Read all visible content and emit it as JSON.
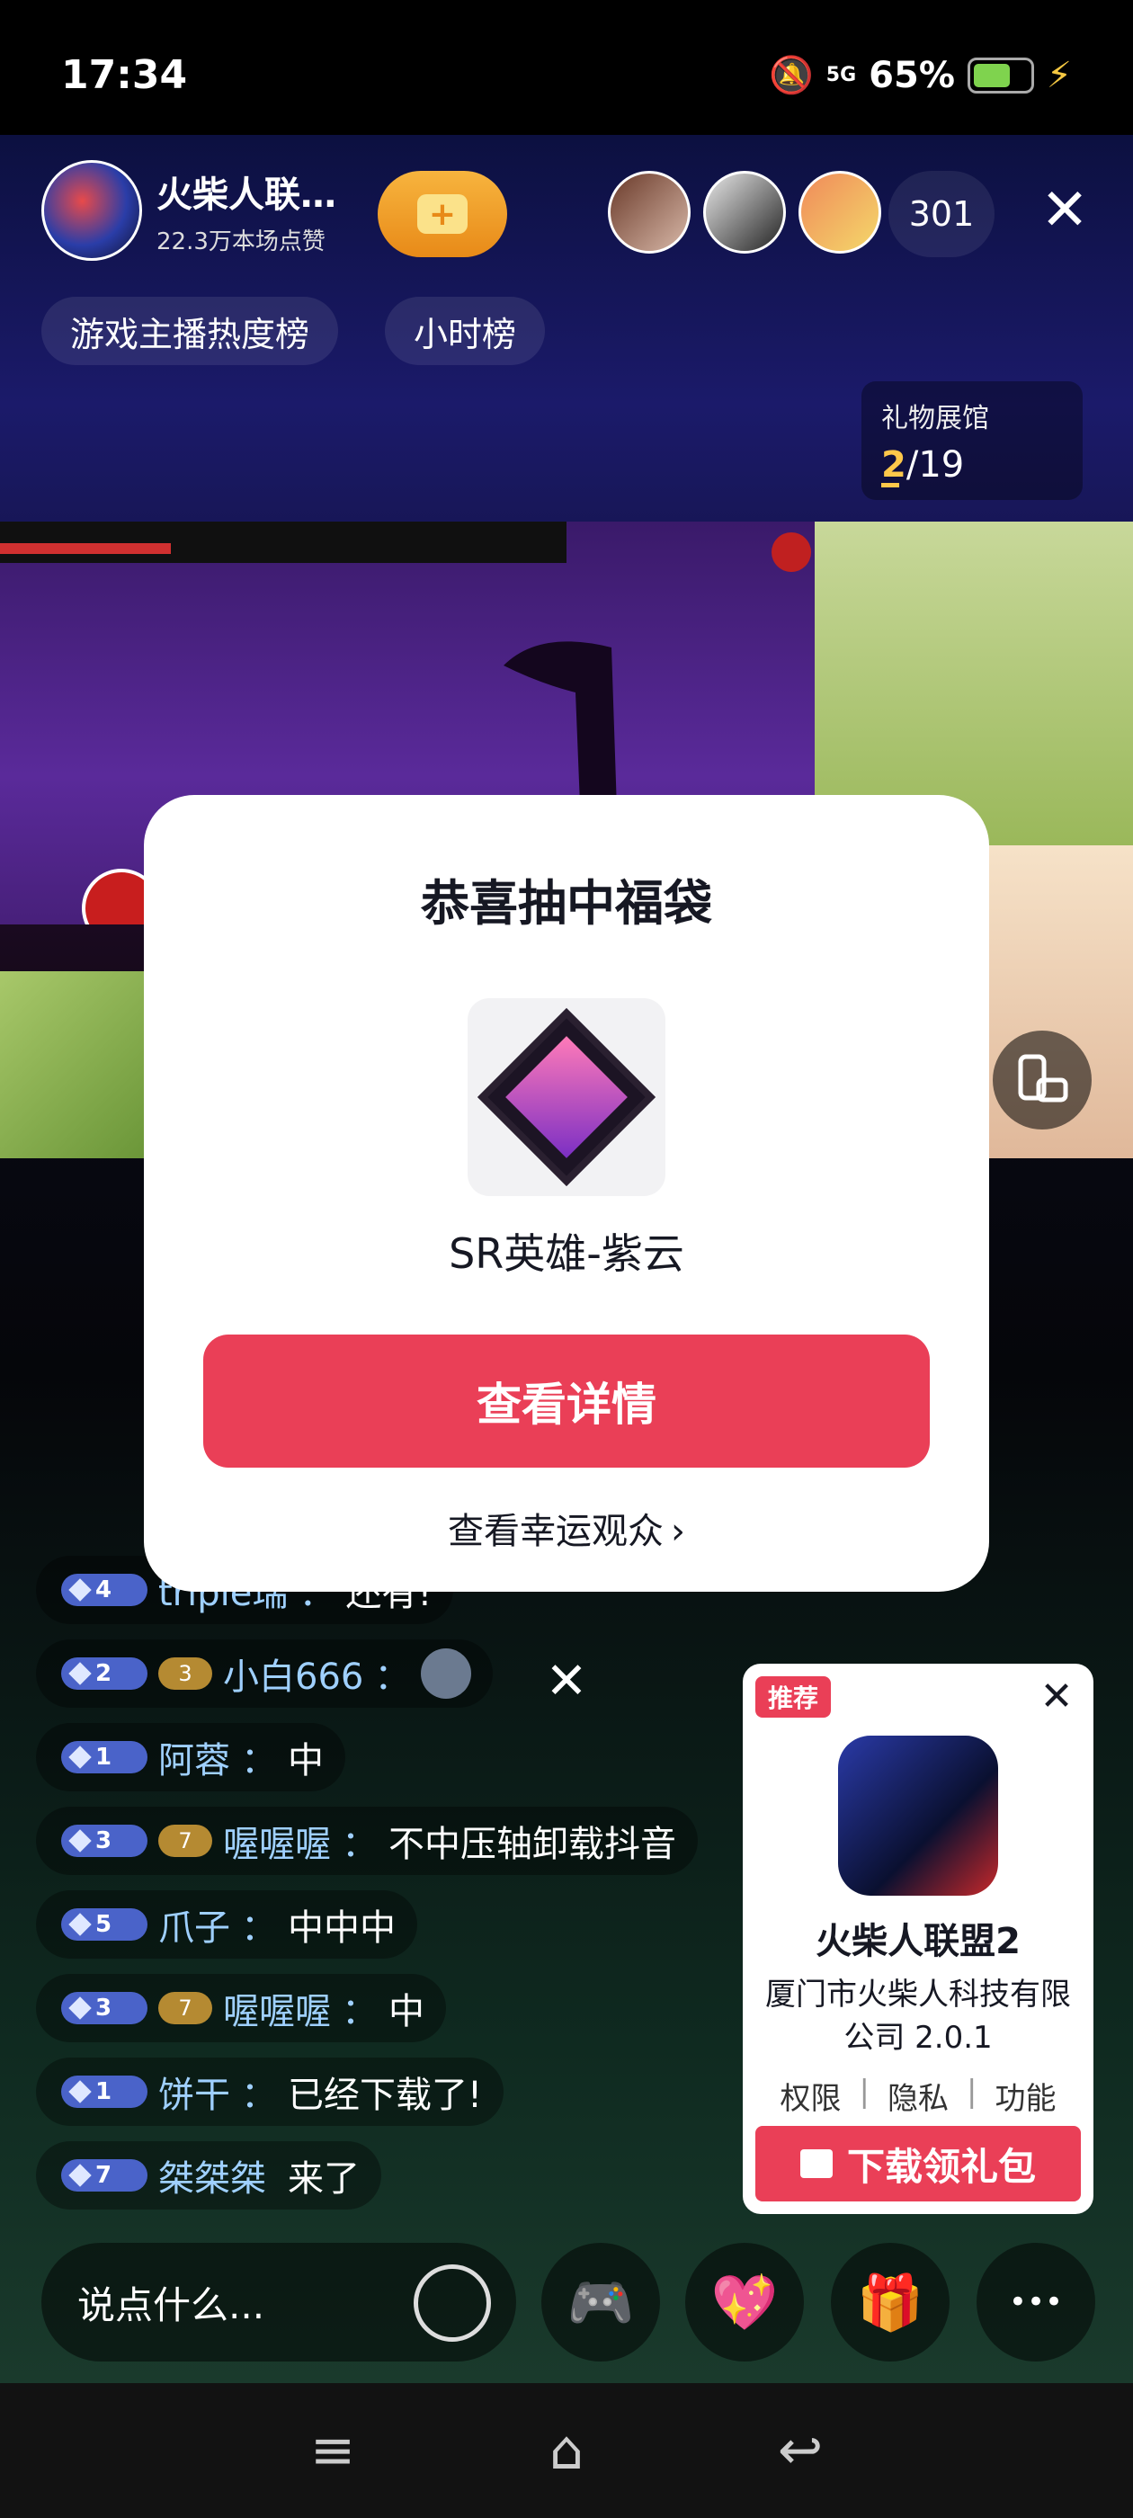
{
  "status_bar": {
    "time": "17:34",
    "network": "5G",
    "battery": "65%",
    "battery_level": 0.65
  },
  "anchor": {
    "name": "火柴人联…",
    "likes": "22.3万本场点赞"
  },
  "viewers": {
    "count": "301"
  },
  "rank_chips": [
    "游戏主播热度榜",
    "小时榜"
  ],
  "gift_hall": {
    "title": "礼物展馆",
    "current": "2",
    "total": "/19"
  },
  "modal": {
    "title": "恭喜抽中福袋",
    "prize_name": "SR英雄-紫云",
    "primary_button": "查看详情",
    "lucky_link": "查看幸运观众",
    "lucky_link_chevron": "›"
  },
  "chat": [
    {
      "level": "4",
      "fan": "",
      "user": "triple瑞",
      "sep": "：",
      "message": "还有!"
    },
    {
      "level": "2",
      "fan": "3",
      "user": "小白666",
      "sep": "：",
      "message": ""
    },
    {
      "level": "1",
      "fan": "",
      "user": "阿蓉",
      "sep": "：",
      "message": "中"
    },
    {
      "level": "3",
      "fan": "7",
      "user": "喔喔喔",
      "sep": "：",
      "message": "不中压轴卸载抖音"
    },
    {
      "level": "5",
      "fan": "",
      "user": "爪子",
      "sep": "：",
      "message": "中中中"
    },
    {
      "level": "3",
      "fan": "7",
      "user": "喔喔喔",
      "sep": "：",
      "message": "中"
    },
    {
      "level": "1",
      "fan": "",
      "user": "饼干",
      "sep": "：",
      "message": "已经下载了!"
    },
    {
      "level": "7",
      "fan": "",
      "user": "桀桀桀",
      "sep": " ",
      "message": "来了"
    }
  ],
  "ad": {
    "tag": "推荐",
    "title": "火柴人联盟2",
    "company": "厦门市火柴人科技有限公司 2.0.1",
    "links": [
      "权限",
      "隐私",
      "功能"
    ],
    "link_separator": "|",
    "download_button": "下载领礼包"
  },
  "bottom": {
    "comment_placeholder": "说点什么..."
  },
  "icons": {
    "close": "✕",
    "game": "🎮",
    "heart": "💖",
    "gift": "🎁",
    "more": "•••",
    "menu": "≡",
    "home": "⌂",
    "back": "↩"
  },
  "colors": {
    "accent_red": "#ea3f57",
    "level_blue": "#4a63c9",
    "follow_orange": "#f7b43e",
    "gift_gold": "#ffc84a"
  }
}
